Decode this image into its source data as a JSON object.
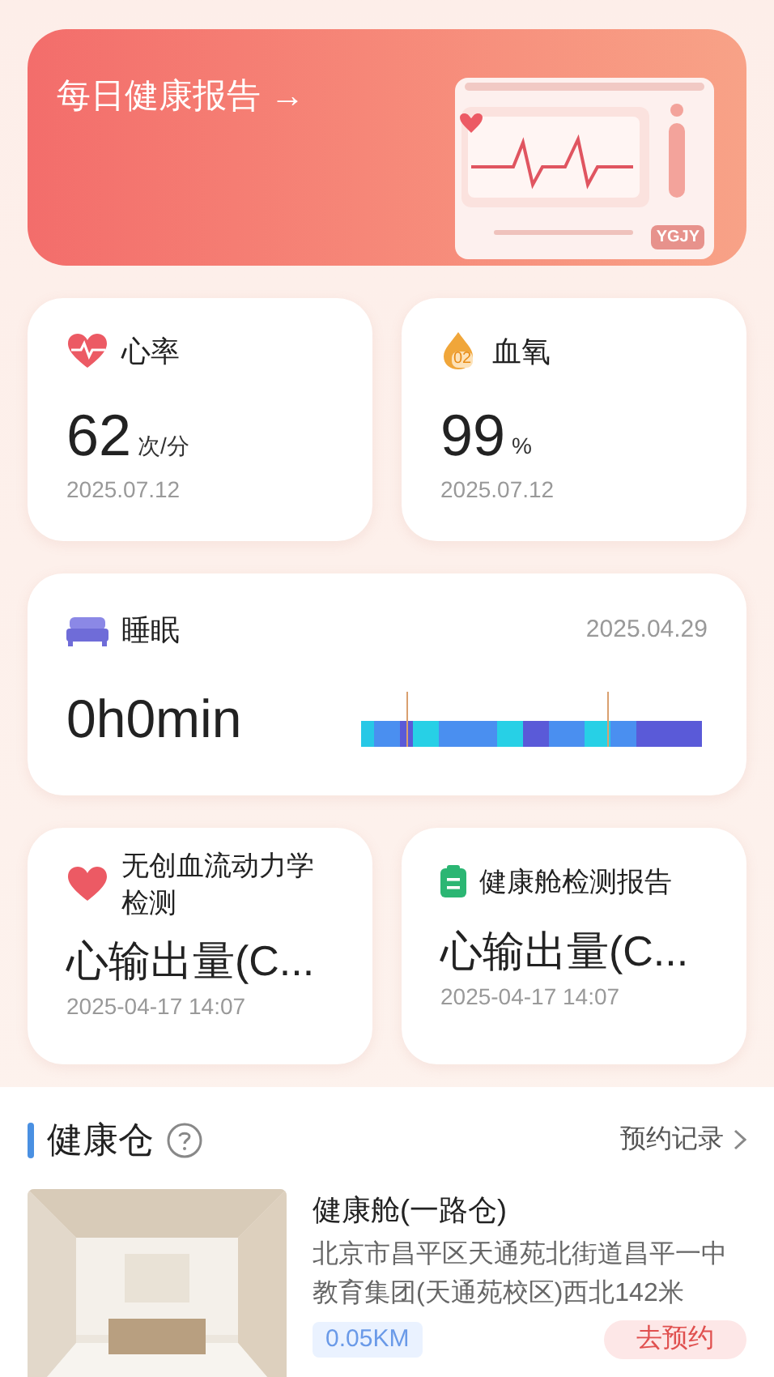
{
  "banner": {
    "title": "每日健康报告",
    "arrow": "→",
    "illustration_label": "YGJY"
  },
  "vitals": [
    {
      "kind": "heart",
      "title": "心率",
      "value": "62",
      "unit": "次/分",
      "date": "2025.07.12"
    },
    {
      "kind": "oxygen",
      "title": "血氧",
      "icon_text": "02",
      "value": "99",
      "unit": "%",
      "date": "2025.07.12"
    }
  ],
  "sleep": {
    "title": "睡眠",
    "date": "2025.04.29",
    "value": "0h0min"
  },
  "reports": [
    {
      "kind": "heart",
      "title": "无创血流动力学检测",
      "value": "心输出量(C...",
      "date": "2025-04-17 14:07"
    },
    {
      "kind": "clipboard",
      "title": "健康舱检测报告",
      "value": "心输出量(C...",
      "date": "2025-04-17 14:07"
    }
  ],
  "section": {
    "title": "健康仓",
    "link": "预约记录"
  },
  "cabins": [
    {
      "name": "健康舱(一路仓)",
      "address": "北京市昌平区天通苑北街道昌平一中教育集团(天通苑校区)西北142米",
      "distance": "0.05KM",
      "action": "去预约"
    }
  ]
}
